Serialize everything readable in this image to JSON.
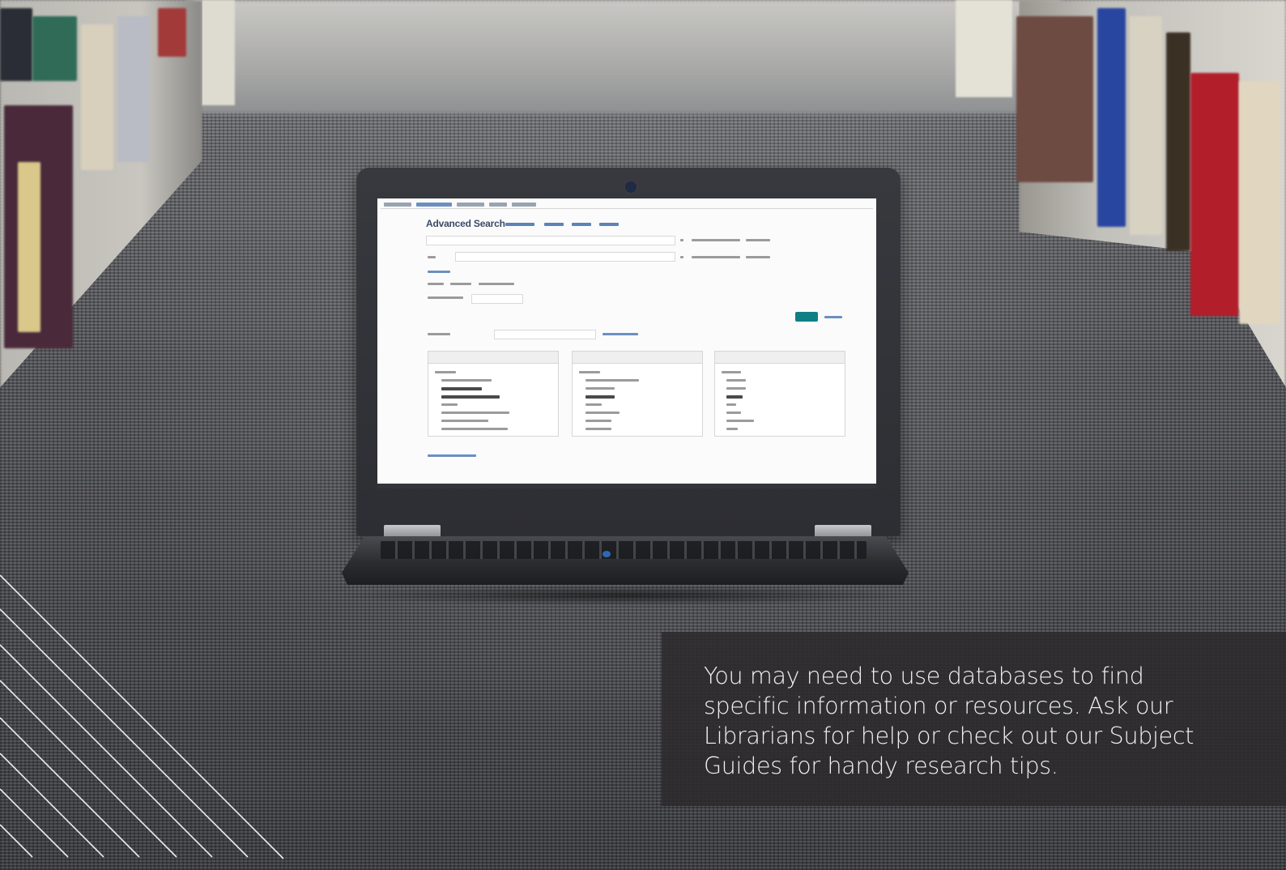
{
  "caption": {
    "text": "You may need to use databases to find specific information or resources. Ask our Librarians for help or check out our Subject Guides for handy research tips."
  },
  "laptop_screen": {
    "page_title": "Advanced Search"
  },
  "colors": {
    "caption_background": "#2c2a2c",
    "caption_text": "#f2f2f2",
    "search_button": "#0f7f86",
    "carpet": "#5b5c61"
  }
}
